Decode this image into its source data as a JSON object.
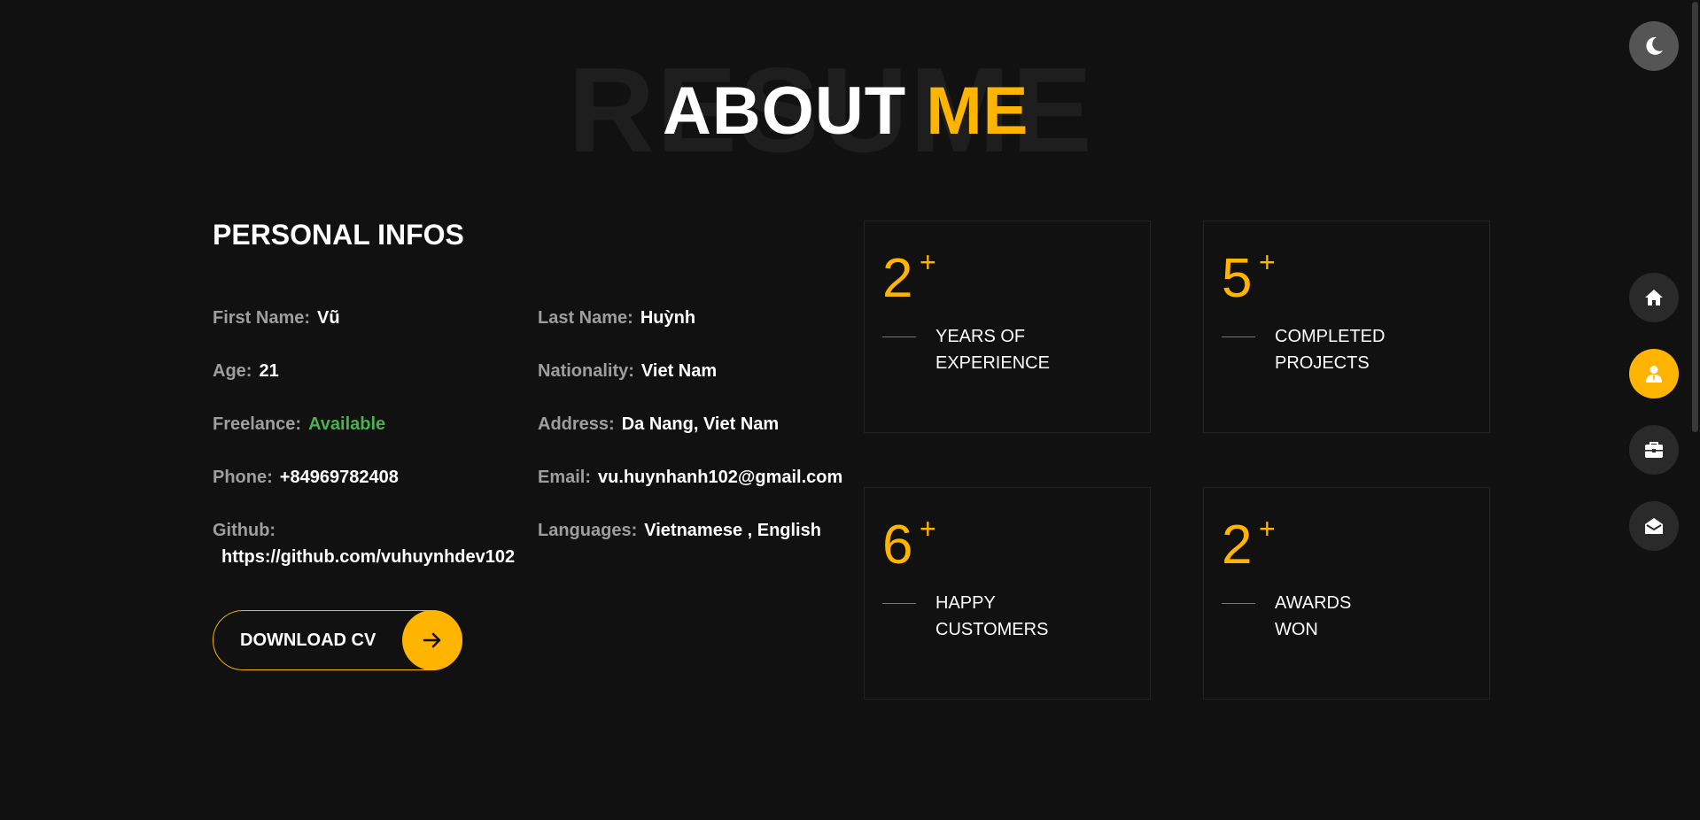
{
  "title": {
    "background_word": "RESUME",
    "word1": "ABOUT",
    "word2": "ME"
  },
  "personal_infos": {
    "heading": "PERSONAL INFOS",
    "first_name": {
      "label": "First Name:",
      "value": "Vũ"
    },
    "last_name": {
      "label": "Last Name:",
      "value": "Huỳnh"
    },
    "age": {
      "label": "Age:",
      "value": "21"
    },
    "nationality": {
      "label": "Nationality:",
      "value": "Viet Nam"
    },
    "freelance": {
      "label": "Freelance:",
      "value": "Available"
    },
    "address": {
      "label": "Address:",
      "value": "Da Nang, Viet Nam"
    },
    "phone": {
      "label": "Phone:",
      "value": "+84969782408"
    },
    "email": {
      "label": "Email:",
      "value": "vu.huynhanh102@gmail.com"
    },
    "github": {
      "label": "Github:",
      "value": "https://github.com/vuhuynhdev102"
    },
    "languages": {
      "label": "Languages:",
      "value": "Vietnamese , English"
    }
  },
  "download_button": {
    "label": "DOWNLOAD CV",
    "icon": "arrow-right-icon"
  },
  "stats": [
    {
      "number": "2",
      "plus": "+",
      "line1": "YEARS OF",
      "line2": "EXPERIENCE"
    },
    {
      "number": "5",
      "plus": "+",
      "line1": "COMPLETED",
      "line2": "PROJECTS"
    },
    {
      "number": "6",
      "plus": "+",
      "line1": "HAPPY",
      "line2": "CUSTOMERS"
    },
    {
      "number": "2",
      "plus": "+",
      "line1": "AWARDS",
      "line2": "WON"
    }
  ],
  "nav": {
    "theme_toggle_icon": "moon-icon",
    "items": [
      {
        "icon": "home-icon",
        "active": false
      },
      {
        "icon": "user-icon",
        "active": true
      },
      {
        "icon": "briefcase-icon",
        "active": false
      },
      {
        "icon": "envelope-open-icon",
        "active": false
      }
    ]
  },
  "colors": {
    "background": "#111111",
    "accent": "#ffb400",
    "label_gray": "#9e9e9e",
    "available_green": "#4caf50",
    "nav_button": "#2b2a2a"
  }
}
